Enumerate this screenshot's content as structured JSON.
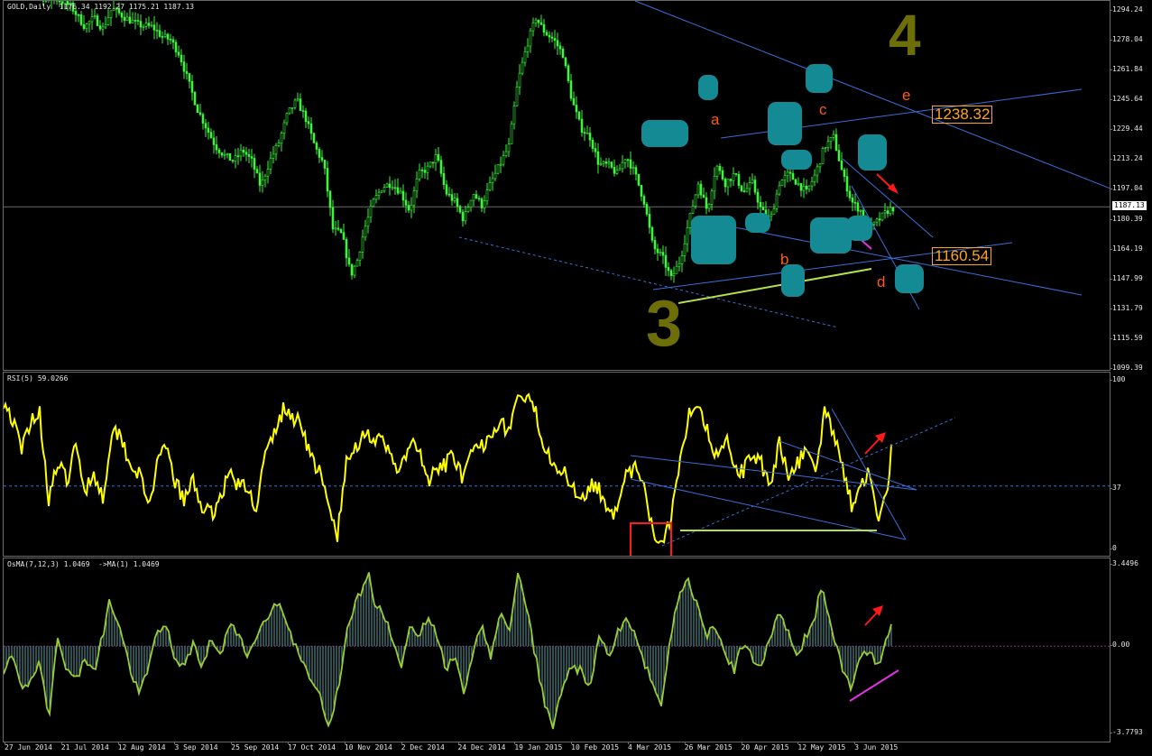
{
  "main_label": "GOLD,Daily  1176.34 1192.27 1175.21 1187.13",
  "rsi_label": "RSI(5) 59.0266",
  "osma_label": "OsMA(7,12,3) 1.0469  ->MA(1) 1.0469",
  "current_price_tag": "1187.13",
  "annotations": {
    "a": "a",
    "b": "b",
    "c": "c",
    "d": "d",
    "e": "e",
    "box_upper": "1238.32",
    "box_lower": "1160.54",
    "wave3": "3",
    "wave4": "4"
  },
  "colors": {
    "candles": "#3ef43e",
    "rsi_line": "#ffff00",
    "osma_line": "#9acd32",
    "osma_bars": "#5f9ea0",
    "trend_lines": "#3a6ed8",
    "support_line": "#b4e14a",
    "magenta_lines": "#e632e6",
    "arrows": "#ff1a1a",
    "handwritten_teal": "#138a94",
    "handwritten_olive": "#6e6e08",
    "wave_labels": "#ff5a14",
    "price_boxes": "#ffa51e"
  },
  "chart_data": [
    {
      "type": "candlestick",
      "title": "GOLD,Daily",
      "ohlc_current": {
        "open": 1176.34,
        "high": 1192.27,
        "low": 1175.21,
        "close": 1187.13
      },
      "ylim": [
        1099.39,
        1294.24
      ],
      "y_ticks": [
        "1294.24",
        "1278.04",
        "1261.84",
        "1245.64",
        "1229.44",
        "1213.24",
        "1197.04",
        "1180.39",
        "1164.19",
        "1147.99",
        "1131.79",
        "1115.59",
        "1099.39"
      ],
      "x_ticks": [
        "27 Jun 2014",
        "21 Jul 2014",
        "12 Aug 2014",
        "3 Sep 2014",
        "25 Sep 2014",
        "17 Oct 2014",
        "10 Nov 2014",
        "2 Dec 2014",
        "24 Dec 2014",
        "19 Jan 2015",
        "10 Feb 2015",
        "4 Mar 2015",
        "26 Mar 2015",
        "20 Apr 2015",
        "12 May 2015",
        "3 Jun 2015"
      ],
      "close_path": [
        [
          0,
          1318
        ],
        [
          15,
          1310
        ],
        [
          30,
          1312
        ],
        [
          45,
          1300
        ],
        [
          60,
          1300
        ],
        [
          75,
          1296
        ],
        [
          90,
          1285
        ],
        [
          100,
          1290
        ],
        [
          110,
          1284
        ],
        [
          120,
          1295
        ],
        [
          135,
          1290
        ],
        [
          150,
          1286
        ],
        [
          165,
          1285
        ],
        [
          175,
          1280
        ],
        [
          185,
          1278
        ],
        [
          195,
          1270
        ],
        [
          205,
          1255
        ],
        [
          215,
          1240
        ],
        [
          225,
          1230
        ],
        [
          235,
          1220
        ],
        [
          245,
          1215
        ],
        [
          255,
          1212
        ],
        [
          265,
          1218
        ],
        [
          275,
          1212
        ],
        [
          285,
          1198
        ],
        [
          295,
          1212
        ],
        [
          305,
          1222
        ],
        [
          315,
          1238
        ],
        [
          325,
          1245
        ],
        [
          335,
          1235
        ],
        [
          345,
          1220
        ],
        [
          355,
          1210
        ],
        [
          365,
          1175
        ],
        [
          375,
          1172
        ],
        [
          385,
          1150
        ],
        [
          392,
          1158
        ],
        [
          400,
          1175
        ],
        [
          410,
          1190
        ],
        [
          420,
          1198
        ],
        [
          430,
          1200
        ],
        [
          440,
          1195
        ],
        [
          450,
          1185
        ],
        [
          460,
          1205
        ],
        [
          470,
          1208
        ],
        [
          480,
          1215
        ],
        [
          490,
          1195
        ],
        [
          500,
          1190
        ],
        [
          510,
          1180
        ],
        [
          520,
          1195
        ],
        [
          530,
          1188
        ],
        [
          540,
          1200
        ],
        [
          550,
          1210
        ],
        [
          560,
          1220
        ],
        [
          570,
          1255
        ],
        [
          580,
          1275
        ],
        [
          590,
          1290
        ],
        [
          600,
          1282
        ],
        [
          610,
          1278
        ],
        [
          620,
          1270
        ],
        [
          630,
          1245
        ],
        [
          640,
          1230
        ],
        [
          650,
          1225
        ],
        [
          660,
          1210
        ],
        [
          670,
          1210
        ],
        [
          680,
          1205
        ],
        [
          690,
          1215
        ],
        [
          700,
          1205
        ],
        [
          710,
          1190
        ],
        [
          720,
          1165
        ],
        [
          730,
          1160
        ],
        [
          740,
          1148
        ],
        [
          750,
          1158
        ],
        [
          760,
          1180
        ],
        [
          770,
          1200
        ],
        [
          780,
          1185
        ],
        [
          790,
          1210
        ],
        [
          800,
          1200
        ],
        [
          810,
          1205
        ],
        [
          820,
          1195
        ],
        [
          830,
          1200
        ],
        [
          840,
          1185
        ],
        [
          850,
          1180
        ],
        [
          860,
          1200
        ],
        [
          870,
          1205
        ],
        [
          880,
          1200
        ],
        [
          890,
          1195
        ],
        [
          900,
          1205
        ],
        [
          910,
          1220
        ],
        [
          920,
          1225
        ],
        [
          930,
          1205
        ],
        [
          940,
          1190
        ],
        [
          950,
          1185
        ],
        [
          960,
          1175
        ],
        [
          970,
          1180
        ],
        [
          980,
          1185
        ],
        [
          988,
          1187
        ]
      ]
    },
    {
      "type": "line",
      "title": "RSI(5)",
      "current_value": 59.0266,
      "ylim": [
        0,
        100
      ],
      "y_ticks": [
        "100",
        "37",
        "0"
      ],
      "reference_level": 37,
      "values_path": [
        [
          0,
          88
        ],
        [
          10,
          76
        ],
        [
          20,
          58
        ],
        [
          30,
          77
        ],
        [
          40,
          80
        ],
        [
          50,
          30
        ],
        [
          60,
          50
        ],
        [
          70,
          40
        ],
        [
          80,
          60
        ],
        [
          90,
          35
        ],
        [
          100,
          45
        ],
        [
          110,
          30
        ],
        [
          120,
          70
        ],
        [
          130,
          68
        ],
        [
          140,
          50
        ],
        [
          150,
          45
        ],
        [
          160,
          25
        ],
        [
          170,
          48
        ],
        [
          180,
          60
        ],
        [
          190,
          40
        ],
        [
          200,
          28
        ],
        [
          210,
          40
        ],
        [
          220,
          25
        ],
        [
          230,
          20
        ],
        [
          240,
          30
        ],
        [
          250,
          45
        ],
        [
          260,
          38
        ],
        [
          270,
          35
        ],
        [
          280,
          25
        ],
        [
          290,
          55
        ],
        [
          300,
          68
        ],
        [
          310,
          82
        ],
        [
          320,
          78
        ],
        [
          330,
          75
        ],
        [
          340,
          55
        ],
        [
          350,
          45
        ],
        [
          360,
          25
        ],
        [
          370,
          8
        ],
        [
          380,
          50
        ],
        [
          390,
          60
        ],
        [
          400,
          70
        ],
        [
          410,
          65
        ],
        [
          420,
          62
        ],
        [
          430,
          55
        ],
        [
          440,
          45
        ],
        [
          450,
          62
        ],
        [
          460,
          58
        ],
        [
          470,
          40
        ],
        [
          480,
          45
        ],
        [
          490,
          50
        ],
        [
          500,
          55
        ],
        [
          510,
          40
        ],
        [
          520,
          58
        ],
        [
          530,
          60
        ],
        [
          540,
          70
        ],
        [
          550,
          75
        ],
        [
          560,
          70
        ],
        [
          570,
          90
        ],
        [
          580,
          88
        ],
        [
          590,
          80
        ],
        [
          600,
          60
        ],
        [
          610,
          52
        ],
        [
          620,
          45
        ],
        [
          630,
          38
        ],
        [
          640,
          30
        ],
        [
          650,
          38
        ],
        [
          660,
          35
        ],
        [
          670,
          25
        ],
        [
          680,
          20
        ],
        [
          690,
          42
        ],
        [
          700,
          48
        ],
        [
          710,
          35
        ],
        [
          720,
          8
        ],
        [
          730,
          5
        ],
        [
          740,
          20
        ],
        [
          750,
          55
        ],
        [
          760,
          80
        ],
        [
          770,
          88
        ],
        [
          780,
          70
        ],
        [
          790,
          55
        ],
        [
          800,
          66
        ],
        [
          810,
          50
        ],
        [
          820,
          45
        ],
        [
          830,
          58
        ],
        [
          840,
          50
        ],
        [
          850,
          35
        ],
        [
          860,
          62
        ],
        [
          870,
          45
        ],
        [
          880,
          50
        ],
        [
          890,
          60
        ],
        [
          900,
          45
        ],
        [
          910,
          80
        ],
        [
          920,
          70
        ],
        [
          930,
          50
        ],
        [
          940,
          25
        ],
        [
          950,
          40
        ],
        [
          960,
          45
        ],
        [
          970,
          15
        ],
        [
          980,
          35
        ],
        [
          984,
          59
        ]
      ]
    },
    {
      "type": "bar",
      "title": "OsMA(7,12,3)",
      "current_value": 1.0469,
      "ma_value": 1.0469,
      "ylim": [
        -3.7793,
        3.4496
      ],
      "y_ticks": [
        "3.4496",
        "0.00",
        "-3.7793"
      ],
      "values_path": [
        [
          0,
          -1.0
        ],
        [
          10,
          -0.5
        ],
        [
          20,
          -2.0
        ],
        [
          30,
          -1.5
        ],
        [
          40,
          -0.5
        ],
        [
          50,
          -3.2
        ],
        [
          60,
          0.5
        ],
        [
          70,
          -1.0
        ],
        [
          80,
          -1.5
        ],
        [
          90,
          -0.5
        ],
        [
          100,
          -1.2
        ],
        [
          110,
          0.5
        ],
        [
          118,
          2.0
        ],
        [
          130,
          0.5
        ],
        [
          140,
          -1.0
        ],
        [
          150,
          -2.0
        ],
        [
          160,
          -1.0
        ],
        [
          170,
          0.5
        ],
        [
          180,
          1.0
        ],
        [
          190,
          -0.5
        ],
        [
          200,
          -1.0
        ],
        [
          210,
          0.2
        ],
        [
          220,
          -1.0
        ],
        [
          230,
          0.5
        ],
        [
          240,
          -0.5
        ],
        [
          250,
          1.0
        ],
        [
          260,
          0.5
        ],
        [
          270,
          -0.5
        ],
        [
          280,
          0.5
        ],
        [
          290,
          1.0
        ],
        [
          300,
          2.0
        ],
        [
          310,
          1.5
        ],
        [
          320,
          0.2
        ],
        [
          330,
          -0.5
        ],
        [
          340,
          -1.5
        ],
        [
          350,
          -2.0
        ],
        [
          360,
          -3.5
        ],
        [
          370,
          -2.0
        ],
        [
          380,
          0.5
        ],
        [
          390,
          2.0
        ],
        [
          400,
          2.5
        ],
        [
          405,
          3.0
        ],
        [
          410,
          2.0
        ],
        [
          420,
          1.5
        ],
        [
          430,
          0.5
        ],
        [
          440,
          -1.0
        ],
        [
          450,
          1.0
        ],
        [
          460,
          0.5
        ],
        [
          470,
          1.2
        ],
        [
          480,
          0.5
        ],
        [
          490,
          -1.0
        ],
        [
          500,
          -0.5
        ],
        [
          510,
          -2.0
        ],
        [
          520,
          -0.5
        ],
        [
          530,
          1.0
        ],
        [
          540,
          -0.5
        ],
        [
          550,
          1.5
        ],
        [
          560,
          0.5
        ],
        [
          570,
          3.2
        ],
        [
          580,
          1.5
        ],
        [
          590,
          -0.5
        ],
        [
          600,
          -2.5
        ],
        [
          610,
          -3.5
        ],
        [
          620,
          -1.5
        ],
        [
          630,
          -1.0
        ],
        [
          640,
          -1.0
        ],
        [
          650,
          -2.0
        ],
        [
          660,
          0.5
        ],
        [
          670,
          -0.5
        ],
        [
          680,
          0.5
        ],
        [
          690,
          1.2
        ],
        [
          700,
          0.5
        ],
        [
          710,
          -0.8
        ],
        [
          720,
          -1.5
        ],
        [
          730,
          -2.5
        ],
        [
          740,
          0.5
        ],
        [
          750,
          2.5
        ],
        [
          760,
          2.8
        ],
        [
          770,
          1.5
        ],
        [
          780,
          0.5
        ],
        [
          790,
          0.8
        ],
        [
          800,
          -0.5
        ],
        [
          810,
          -1.0
        ],
        [
          820,
          0.2
        ],
        [
          830,
          -0.5
        ],
        [
          840,
          -1.0
        ],
        [
          850,
          0.5
        ],
        [
          860,
          1.5
        ],
        [
          870,
          0.5
        ],
        [
          880,
          -0.5
        ],
        [
          890,
          0.5
        ],
        [
          900,
          1.2
        ],
        [
          905,
          2.5
        ],
        [
          910,
          2.0
        ],
        [
          920,
          0.5
        ],
        [
          930,
          -1.0
        ],
        [
          940,
          -1.8
        ],
        [
          950,
          -0.5
        ],
        [
          960,
          -0.2
        ],
        [
          970,
          -1.0
        ],
        [
          980,
          0.5
        ],
        [
          984,
          1.0469
        ]
      ]
    }
  ]
}
